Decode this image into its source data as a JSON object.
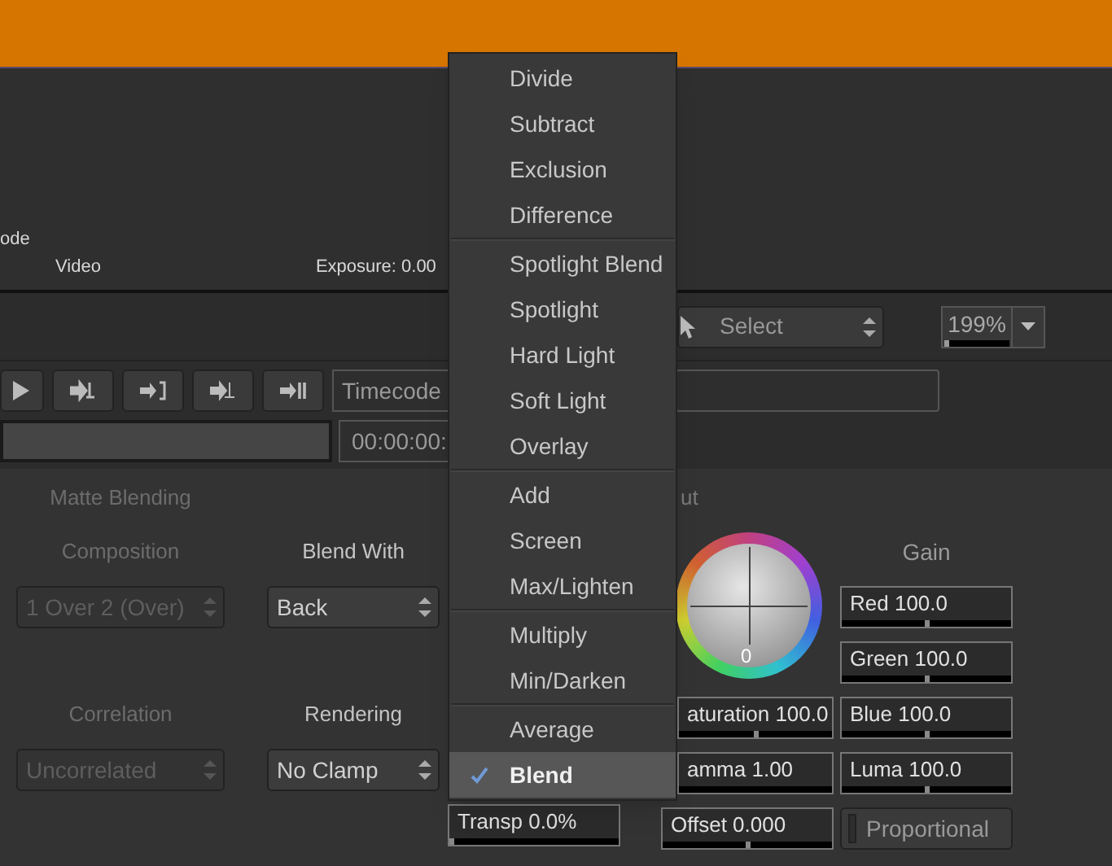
{
  "header": {
    "cut_label": "ode",
    "video_label": "Video",
    "exposure": "Exposure: 0.00"
  },
  "toolbar": {
    "tool_select": {
      "value": "Select"
    },
    "zoom": {
      "value": "199%",
      "level": 0
    }
  },
  "transport": {
    "buttons": [
      {
        "kind": "play"
      },
      {
        "kind": "to-mark-in"
      },
      {
        "kind": "to-bracket"
      },
      {
        "kind": "to-mark-out"
      },
      {
        "kind": "to-pause"
      }
    ],
    "timecode_label": "Timecode"
  },
  "timeline": {
    "timecode": "00:00:00:"
  },
  "matte_blending": {
    "title": "Matte Blending",
    "disabled": true,
    "controls": [
      {
        "label": "Composition",
        "value": "1 Over 2 (Over)",
        "disabled": true
      },
      {
        "label": "Blend With",
        "value": "Back",
        "disabled": false
      },
      {
        "label": "Correlation",
        "value": "Uncorrelated",
        "disabled": true
      },
      {
        "label": "Rendering",
        "value": "No Clamp",
        "disabled": false
      }
    ],
    "transparency": {
      "value": "Transp 0.0%",
      "level": 0
    }
  },
  "color": {
    "section_label": "ut",
    "wheel_value": "0",
    "fields": [
      {
        "value": "aturation 100.0",
        "level": 0.5
      },
      {
        "value": "amma 1.00"
      },
      {
        "value": "Offset 0.000",
        "level": 0.5
      }
    ],
    "gain": {
      "label": "Gain",
      "fields": [
        {
          "value": "Red 100.0",
          "level": 0.5
        },
        {
          "value": "Green 100.0",
          "level": 0.5
        },
        {
          "value": "Blue 100.0",
          "level": 0.5
        },
        {
          "value": "Luma 100.0",
          "level": 0.5
        }
      ],
      "proportional": {
        "label": "Proportional",
        "checked": false
      }
    }
  },
  "menu": {
    "groups": [
      [
        {
          "label": "Divide",
          "selected": false
        },
        {
          "label": "Subtract",
          "selected": false
        },
        {
          "label": "Exclusion",
          "selected": false
        },
        {
          "label": "Difference",
          "selected": false
        }
      ],
      [
        {
          "label": "Spotlight Blend",
          "selected": false
        },
        {
          "label": "Spotlight",
          "selected": false
        },
        {
          "label": "Hard Light",
          "selected": false
        },
        {
          "label": "Soft Light",
          "selected": false
        },
        {
          "label": "Overlay",
          "selected": false
        }
      ],
      [
        {
          "label": "Add",
          "selected": false
        },
        {
          "label": "Screen",
          "selected": false
        },
        {
          "label": "Max/Lighten",
          "selected": false
        }
      ],
      [
        {
          "label": "Multiply",
          "selected": false
        },
        {
          "label": "Min/Darken",
          "selected": false
        }
      ],
      [
        {
          "label": "Average",
          "selected": false
        },
        {
          "label": "Blend",
          "selected": true
        }
      ]
    ]
  }
}
